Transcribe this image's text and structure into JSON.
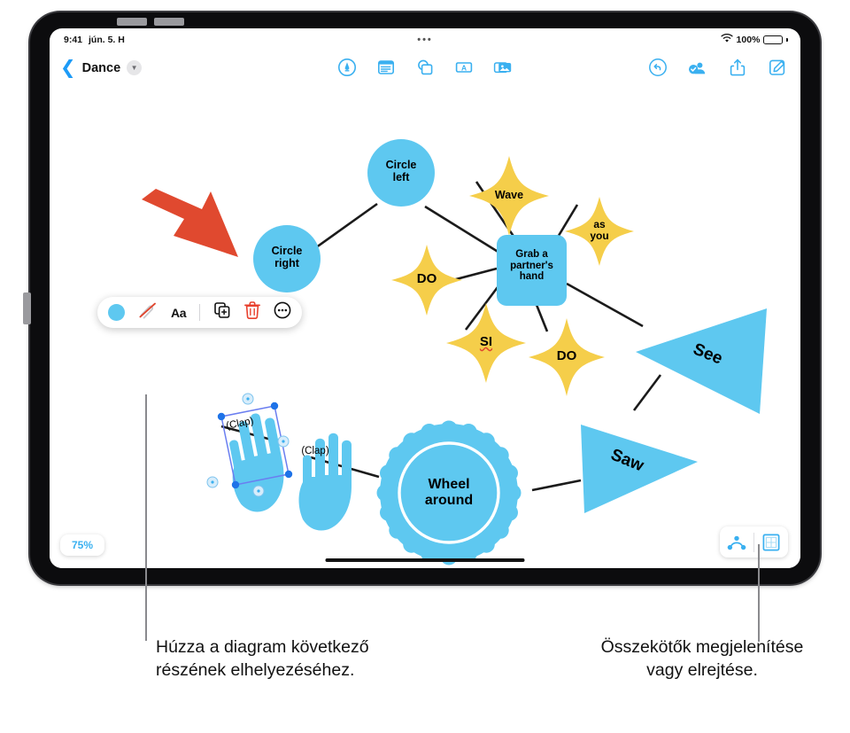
{
  "status_bar": {
    "time": "9:41",
    "date": "jún. 5. H",
    "center_dots": "•••",
    "wifi_icon": "wifi-icon",
    "battery_percent": "100%"
  },
  "nav_bar": {
    "back_icon": "chevron-left-icon",
    "document_title": "Dance",
    "title_menu_icon": "chevron-down-icon",
    "center_tools": [
      {
        "name": "draw-tool",
        "icon": "pen-circle-icon"
      },
      {
        "name": "table-tool",
        "icon": "table-icon"
      },
      {
        "name": "shape-tool",
        "icon": "shapes-icon"
      },
      {
        "name": "text-tool",
        "icon": "text-box-icon"
      },
      {
        "name": "media-tool",
        "icon": "media-icon"
      }
    ],
    "right_tools": [
      {
        "name": "undo-button",
        "icon": "undo-icon"
      },
      {
        "name": "collaborate-button",
        "icon": "collaborate-icon"
      },
      {
        "name": "share-button",
        "icon": "share-icon"
      },
      {
        "name": "compose-button",
        "icon": "compose-icon"
      }
    ]
  },
  "format_toolbar": {
    "fill_color": "#5EC8F0",
    "fill_swatch_name": "fill-color-swatch",
    "pen_icon": "no-stroke-icon",
    "text_style_label": "Aa",
    "duplicate_icon": "duplicate-icon",
    "delete_icon": "trash-icon",
    "delete_color": "#E8412E",
    "more_icon": "more-ellipsis-icon"
  },
  "canvas": {
    "zoom_level": "75%",
    "connectors_icon": "connectors-icon",
    "grid_icon": "grid-icon",
    "shape_blue": "#5EC8F0",
    "shape_yellow": "#F5CE4A",
    "arrow_red": "#E0492F",
    "nodes": [
      {
        "id": "circle-left",
        "label": "Circle\nleft",
        "shape": "circle"
      },
      {
        "id": "circle-right",
        "label": "Circle\nright",
        "shape": "circle"
      },
      {
        "id": "wave",
        "label": "Wave",
        "shape": "star"
      },
      {
        "id": "as-you",
        "label": "as\nyou",
        "shape": "star"
      },
      {
        "id": "grab-partner",
        "label": "Grab a\npartner's\nhand",
        "shape": "rounded-rect"
      },
      {
        "id": "do-left",
        "label": "DO",
        "shape": "star"
      },
      {
        "id": "si",
        "label": "SI",
        "shape": "star",
        "spellcheck_error": true
      },
      {
        "id": "do-right",
        "label": "DO",
        "shape": "star"
      },
      {
        "id": "see",
        "label": "See",
        "shape": "triangle"
      },
      {
        "id": "saw",
        "label": "Saw",
        "shape": "triangle"
      },
      {
        "id": "clap-selected",
        "label": "(Clap)",
        "shape": "hand"
      },
      {
        "id": "clap-second",
        "label": "(Clap)",
        "shape": "hand"
      },
      {
        "id": "wheel-around",
        "label": "Wheel\naround",
        "shape": "scalloped-circle"
      }
    ],
    "labels": {
      "circle_left": "Circle left",
      "circle_right": "Circle right",
      "wave": "Wave",
      "as_you_line1": "as",
      "as_you_line2": "you",
      "grab_line1": "Grab a",
      "grab_line2": "partner's",
      "grab_line3": "hand",
      "do_left": "DO",
      "si": "SI",
      "do_right": "DO",
      "see": "See",
      "saw": "Saw",
      "clap_one": "(Clap)",
      "clap_two": "(Clap)",
      "wheel_line1": "Wheel",
      "wheel_line2": "around",
      "circle_left_line1": "Circle",
      "circle_left_line2": "left",
      "circle_right_line1": "Circle",
      "circle_right_line2": "right"
    },
    "selection": {
      "handle_color": "#1E73E8",
      "rotation_handle_icon": "rotate-handle-icon"
    }
  },
  "callouts": {
    "left": "Húzza a diagram következő részének elhelyezéséhez.",
    "right": "Összekötők megjelenítése vagy elrejtése."
  }
}
